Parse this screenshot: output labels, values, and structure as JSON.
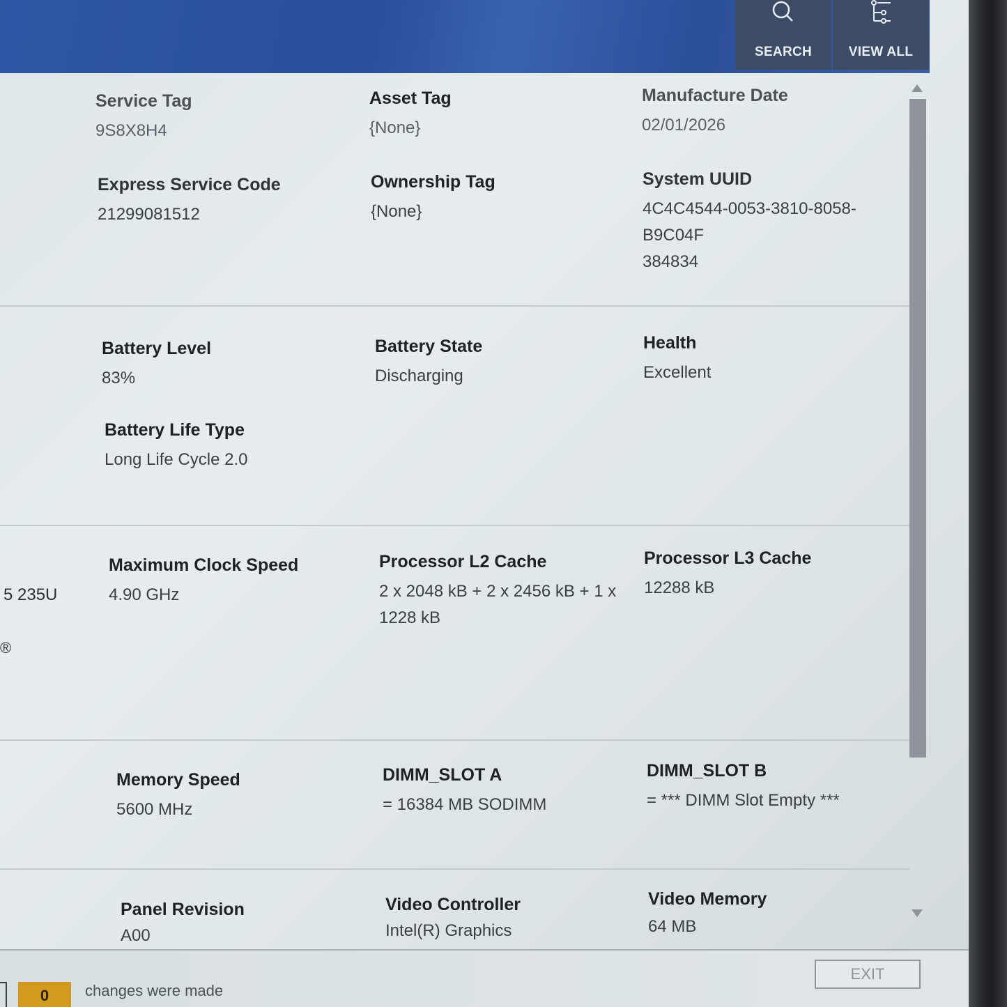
{
  "header": {
    "search_label": "SEARCH",
    "view_all_label": "VIEW ALL"
  },
  "sections": {
    "identity": {
      "service_tag": {
        "label": "Service Tag",
        "value": "9S8X8H4"
      },
      "asset_tag": {
        "label": "Asset Tag",
        "value": "{None}"
      },
      "manufacture_date": {
        "label": "Manufacture Date",
        "value": "02/01/2026"
      },
      "express_service_code": {
        "label": "Express Service Code",
        "value": "21299081512"
      },
      "ownership_tag": {
        "label": "Ownership Tag",
        "value": "{None}"
      },
      "system_uuid": {
        "label": "System UUID",
        "value_line1": "4C4C4544-0053-3810-8058-B9C04F",
        "value_line2": "384834"
      }
    },
    "battery": {
      "level": {
        "label": "Battery Level",
        "value": "83%"
      },
      "state": {
        "label": "Battery State",
        "value": "Discharging"
      },
      "health": {
        "label": "Health",
        "value": "Excellent"
      },
      "life_type": {
        "label": "Battery Life Type",
        "value": "Long Life Cycle 2.0"
      }
    },
    "processor": {
      "partial_model": "5 235U",
      "partial_mark": "®",
      "max_clock": {
        "label": "Maximum Clock Speed",
        "value": "4.90 GHz"
      },
      "l2_cache": {
        "label": "Processor L2 Cache",
        "value_line1": "2 x 2048  kB + 2 x 2456  kB + 1 x",
        "value_line2": "1228  kB"
      },
      "l3_cache": {
        "label": "Processor L3 Cache",
        "value": "12288 kB"
      }
    },
    "memory": {
      "speed": {
        "label": "Memory Speed",
        "value": "5600 MHz"
      },
      "dimm_a": {
        "label": "DIMM_SLOT A",
        "value": "= 16384 MB SODIMM"
      },
      "dimm_b": {
        "label": "DIMM_SLOT B",
        "value": "= *** DIMM Slot Empty ***"
      }
    },
    "video": {
      "panel_revision": {
        "label": "Panel Revision",
        "value": "A00"
      },
      "video_controller": {
        "label": "Video Controller",
        "value": "Intel(R) Graphics"
      },
      "video_memory": {
        "label": "Video Memory",
        "value": "64 MB"
      }
    }
  },
  "footer": {
    "changes_count": "0",
    "changes_text": "changes were made",
    "exit_label": "EXIT"
  }
}
